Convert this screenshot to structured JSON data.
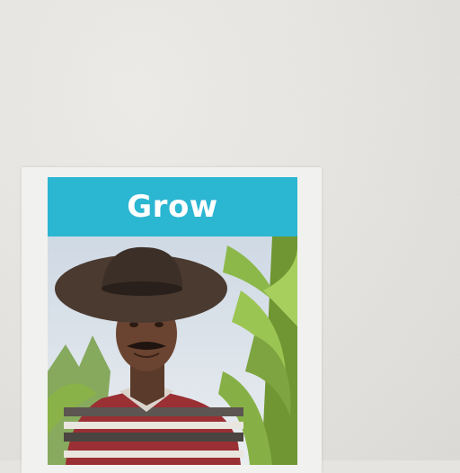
{
  "poster": {
    "title": "Grow",
    "accent_color": "#2bb6d2",
    "photo_subject": "farmer-in-wide-brim-hat-with-corn-plants"
  }
}
